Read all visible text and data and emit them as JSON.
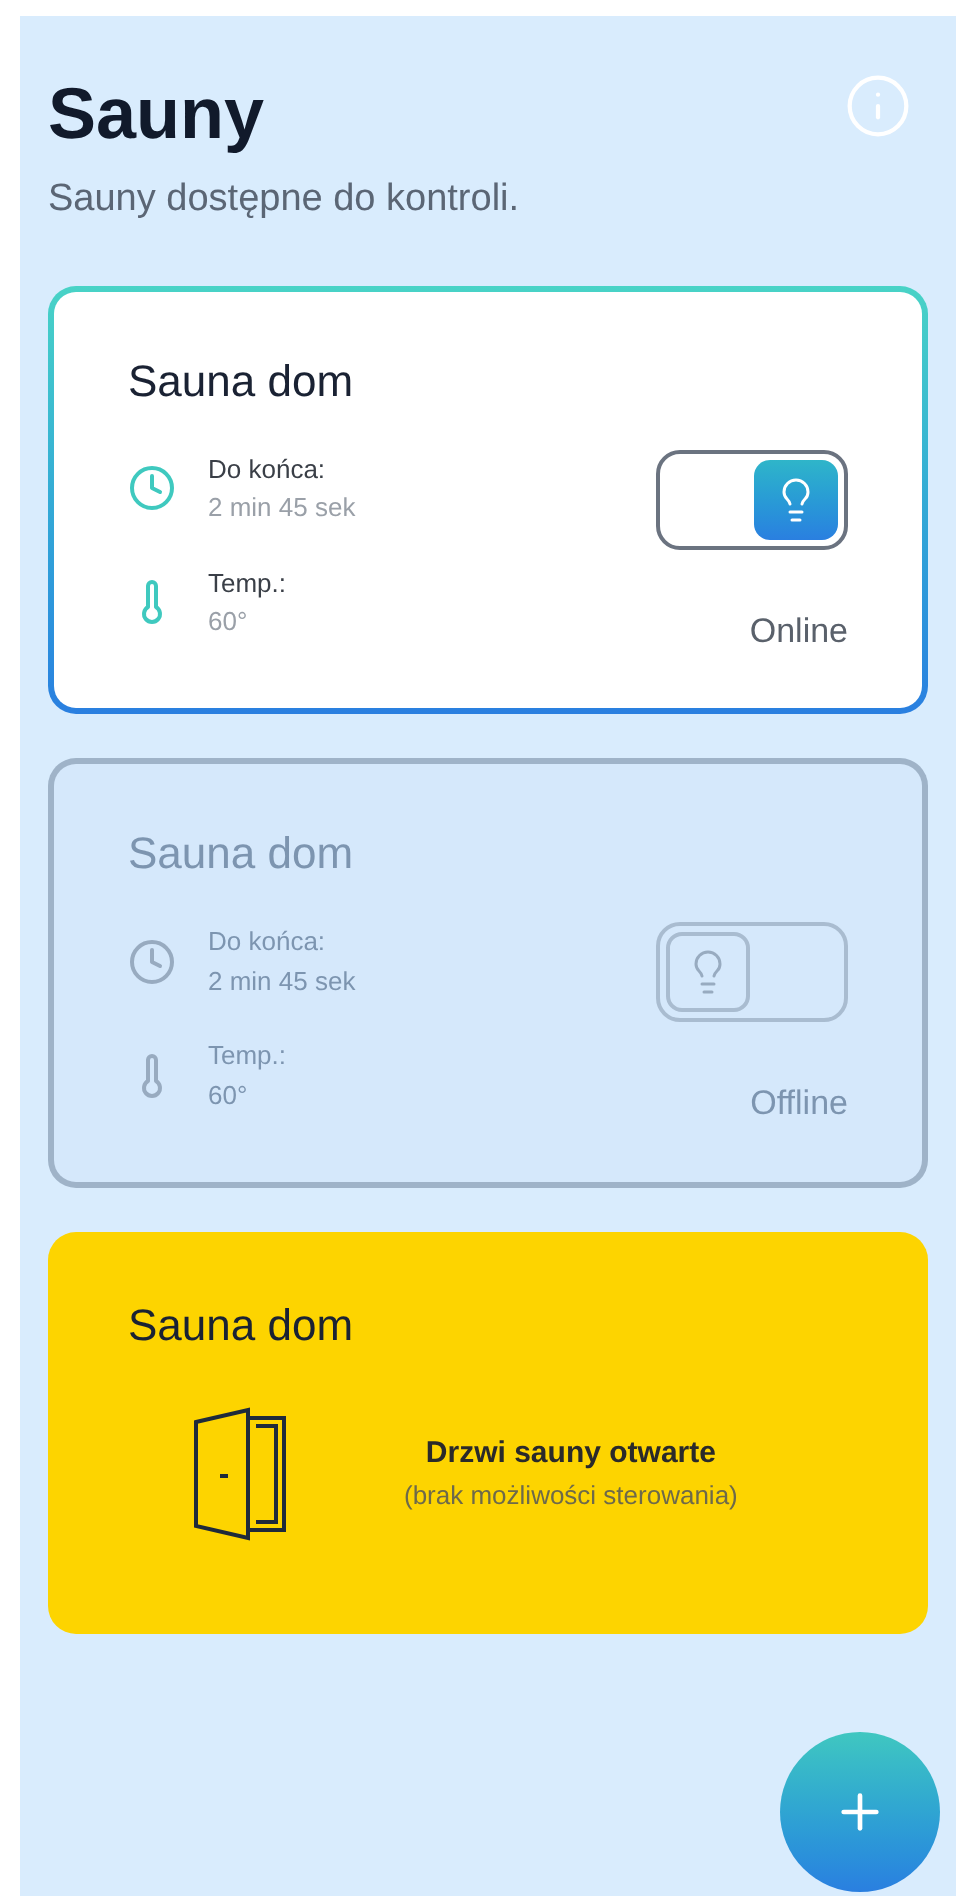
{
  "header": {
    "title": "Sauny",
    "subtitle": "Sauny dostępne do kontroli."
  },
  "saunas": [
    {
      "kind": "control",
      "name": "Sauna dom",
      "online": true,
      "timer_label": "Do końca:",
      "timer_value": "2 min 45 sek",
      "temp_label": "Temp.:",
      "temp_value": "60°",
      "light_on": true,
      "status": "Online"
    },
    {
      "kind": "control",
      "name": "Sauna dom",
      "online": false,
      "timer_label": "Do końca:",
      "timer_value": "2 min 45 sek",
      "temp_label": "Temp.:",
      "temp_value": "60°",
      "light_on": false,
      "status": "Offline"
    },
    {
      "kind": "door_open",
      "name": "Sauna dom",
      "message": "Drzwi sauny otwarte",
      "note": "(brak możliwości sterowania)"
    }
  ]
}
